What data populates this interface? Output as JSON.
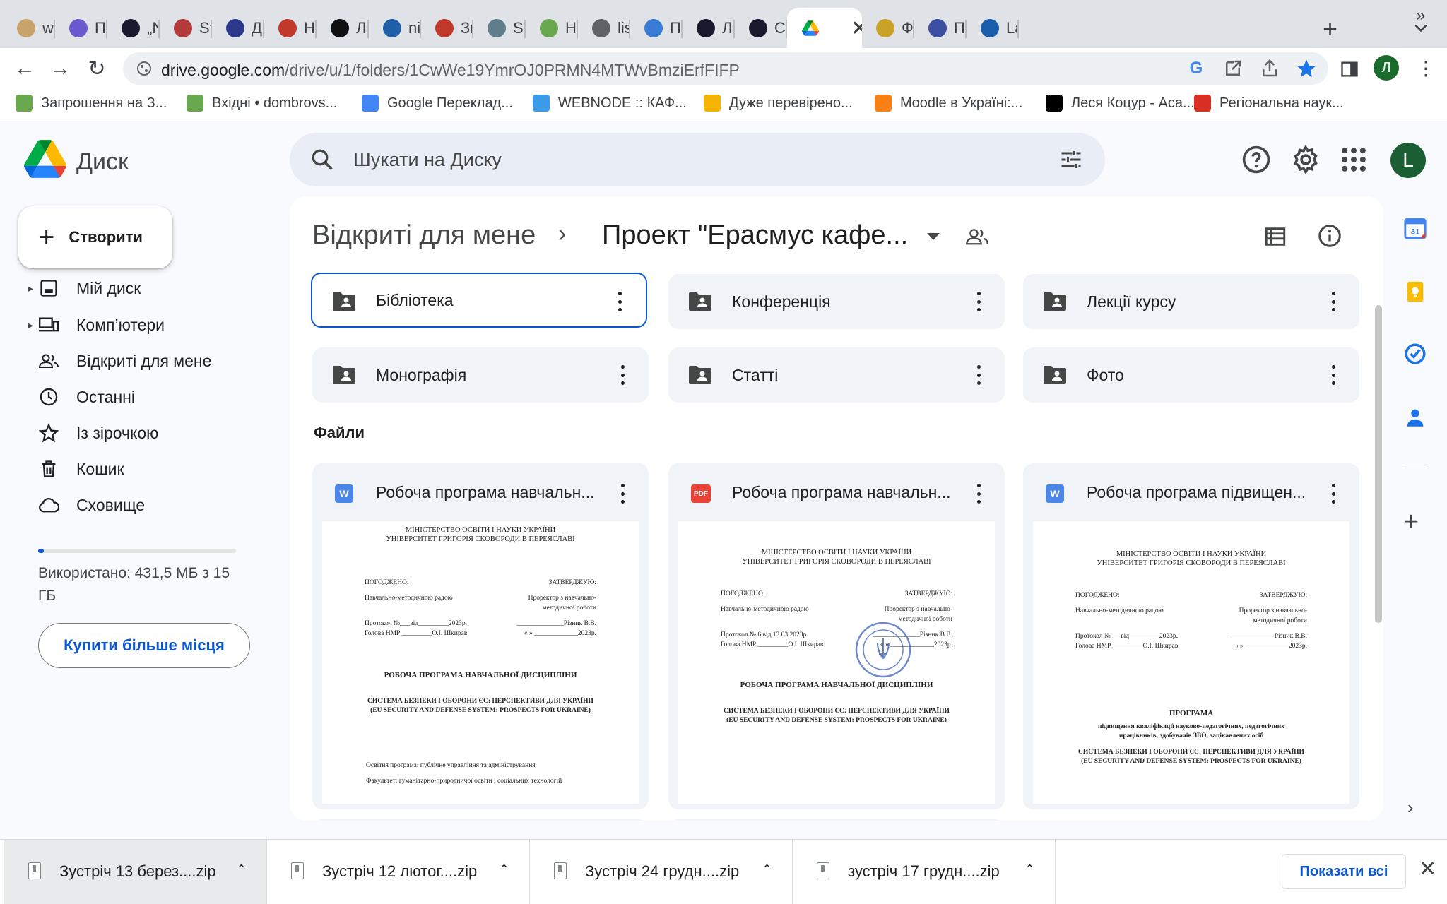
{
  "browser": {
    "tabs": [
      {
        "label": "ww",
        "icon": "plate-icon",
        "color": "#c9a46a"
      },
      {
        "label": "Прс",
        "icon": "c-circle-icon",
        "color": "#6a5acd"
      },
      {
        "label": "„Ne",
        "icon": "lrt-icon",
        "color": "#1a1a2e"
      },
      {
        "label": "Stra",
        "icon": "emblem-icon",
        "color": "#b33a3a"
      },
      {
        "label": "Дов",
        "icon": "cyrillic-d-icon",
        "color": "#2d3a8c"
      },
      {
        "label": "Нау",
        "icon": "flower-icon",
        "color": "#c0392b"
      },
      {
        "label": "Лит",
        "icon": "b-circle-icon",
        "color": "#111111"
      },
      {
        "label": "niss",
        "icon": "niss-icon",
        "color": "#1f5fa8"
      },
      {
        "label": "Звіт",
        "icon": "pdf-flag-icon",
        "color": "#c0392b"
      },
      {
        "label": "Sec",
        "icon": "doc-icon",
        "color": "#607d8b"
      },
      {
        "label": "Наг",
        "icon": "envelope-icon",
        "color": "#6aa84f"
      },
      {
        "label": "list.",
        "icon": "globe-icon",
        "color": "#5f6368"
      },
      {
        "label": "Пре",
        "icon": "puzzle-icon",
        "color": "#3a7bd5"
      },
      {
        "label": "Лев",
        "icon": "eu-icon",
        "color": "#1a1a2e"
      },
      {
        "label": "Cor",
        "icon": "eu-icon",
        "color": "#1a1a2e"
      },
      {
        "label": "",
        "icon": "google-drive-icon",
        "color": "#ffffff",
        "active": true
      },
      {
        "label": "Фак",
        "icon": "crest-icon",
        "color": "#c9a227"
      },
      {
        "label": "Про",
        "icon": "crest-icon",
        "color": "#3b4ea0"
      },
      {
        "label": "Lan",
        "icon": "lt-icon",
        "color": "#1a5dab"
      }
    ],
    "url_host": "drive.google.com",
    "url_path": "/drive/u/1/folders/1CwWe19YmrOJ0PRMN4MTWvBmziErfFIFP",
    "profile_initial": "Л",
    "bookmarks": [
      {
        "label": "Запрошення на З...",
        "icon": "envelope-icon",
        "color": "#6aa84f"
      },
      {
        "label": "Вхідні • dombrovs...",
        "icon": "envelope-icon",
        "color": "#6aa84f"
      },
      {
        "label": "Google Переклад...",
        "icon": "translate-icon",
        "color": "#4285f4"
      },
      {
        "label": "WEBNODE :: КАФ...",
        "icon": "webnode-icon",
        "color": "#3c9be8"
      },
      {
        "label": "Дуже перевірено...",
        "icon": "thumb-icon",
        "color": "#f4b400"
      },
      {
        "label": "Moodle в Україні:...",
        "icon": "moodle-icon",
        "color": "#f98012"
      },
      {
        "label": "Леся Коцур - Aca...",
        "icon": "academia-icon",
        "color": "#000000"
      },
      {
        "label": "Регіональна наук...",
        "icon": "flower-icon",
        "color": "#d93025"
      }
    ]
  },
  "drive": {
    "product_name": "Диск",
    "search_placeholder": "Шукати на Диску",
    "account_initial": "L",
    "new_button": "Створити",
    "nav": [
      {
        "label": "Мій диск",
        "icon": "my-drive-icon",
        "caret": true
      },
      {
        "label": "Комп’ютери",
        "icon": "computers-icon",
        "caret": true
      },
      {
        "label": "Відкриті для мене",
        "icon": "shared-icon",
        "caret": false
      },
      {
        "label": "Останні",
        "icon": "clock-icon",
        "caret": false
      },
      {
        "label": "Із зірочкою",
        "icon": "star-icon",
        "caret": false
      },
      {
        "label": "Кошик",
        "icon": "trash-icon",
        "caret": false
      },
      {
        "label": "Сховище",
        "icon": "cloud-icon",
        "caret": false
      }
    ],
    "storage": {
      "text": "Використано: 431,5 МБ з 15 ГБ",
      "used_fraction": 0.028
    },
    "buy_storage": "Купити більше місця"
  },
  "main": {
    "breadcrumb_root": "Відкриті для мене",
    "breadcrumb_current": "Проект \"Ерасмус кафе...",
    "folders": [
      {
        "name": "Бібліотека",
        "selected": true
      },
      {
        "name": "Конференція",
        "selected": false
      },
      {
        "name": "Лекції курсу",
        "selected": false
      },
      {
        "name": "Монографія",
        "selected": false
      },
      {
        "name": "Статті",
        "selected": false
      },
      {
        "name": "Фото",
        "selected": false
      }
    ],
    "files_heading": "Файли",
    "files": [
      {
        "name": "Робоча програма навчальн...",
        "type_badge": "W",
        "type_color": "#4a86e8",
        "preview": {
          "ministry": "МІНІСТЕРСТВО ОСВІТИ І НАУКИ УКРАЇНИ",
          "university": "УНІВЕРСИТЕТ ГРИГОРІЯ СКОВОРОДИ В ПЕРЕЯСЛАВІ",
          "agreed": "ПОГОДЖЕНО:",
          "approved": "ЗАТВЕРДЖУЮ:",
          "council": "Навчально-методичною радою",
          "prorector": "Проректор з навчально-",
          "prorector2": "методичної роботи",
          "protocol": "Протокол №___від_________2023р.",
          "signer": "______________Різник В.В.",
          "head": "Голова НМР _________О.І. Шкирав",
          "date": "« » _____________2023р.",
          "doc_title": "РОБОЧА ПРОГРАМА НАВЧАЛЬНОЇ ДИСЦИПЛІНИ",
          "subject": "СИСТЕМА БЕЗПЕКИ І ОБОРОНИ ЄС: ПЕРСПЕКТИВИ ДЛЯ УКРАЇНИ",
          "subject_en": "(EU SECURITY AND DEFENSE SYSTEM: PROSPECTS FOR UKRAINE)",
          "program": "Освітня програма: публічне управління та адміністрування",
          "faculty": "Факультет: гуманітарно-природничої освіти і соціальних технологій"
        }
      },
      {
        "name": "Робоча програма навчальн...",
        "type_badge": "PDF",
        "type_color": "#ea4335",
        "preview": {
          "ministry": "МІНІСТЕРСТВО ОСВІТИ І НАУКИ УКРАЇНИ",
          "university": "УНІВЕРСИТЕТ ГРИГОРІЯ СКОВОРОДИ В ПЕРЕЯСЛАВІ",
          "agreed": "ПОГОДЖЕНО:",
          "approved": "ЗАТВЕРДЖУЮ:",
          "council": "Навчально-методичною радою",
          "prorector": "Проректор з навчально-",
          "prorector2": "методичної роботи",
          "protocol": "Протокол № 6 від 13.03 2023р.",
          "signer": "______________Різник В.В.",
          "head": "Голова НМР _________О.І. Шкирав",
          "date": "« » _____________2023р.",
          "doc_title": "РОБОЧА ПРОГРАМА НАВЧАЛЬНОЇ ДИСЦИПЛІНИ",
          "subject": "СИСТЕМА БЕЗПЕКИ І ОБОРОНИ ЄС: ПЕРСПЕКТИВИ ДЛЯ УКРАЇНИ",
          "subject_en": "(EU SECURITY AND DEFENSE SYSTEM: PROSPECTS FOR UKRAINE)"
        }
      },
      {
        "name": "Робоча програма підвищен...",
        "type_badge": "W",
        "type_color": "#4a86e8",
        "preview": {
          "ministry": "МІНІСТЕРСТВО ОСВІТИ І НАУКИ УКРАЇНИ",
          "university": "УНІВЕРСИТЕТ ГРИГОРІЯ СКОВОРОДИ В ПЕРЕЯСЛАВІ",
          "agreed": "ПОГОДЖЕНО:",
          "approved": "ЗАТВЕРДЖУЮ:",
          "council": "Навчально-методичною радою",
          "prorector": "Проректор з навчально-",
          "prorector2": "методичної роботи",
          "protocol": "Протокол №___від_________2023р.",
          "signer": "______________Різник В.В.",
          "head": "Голова НМР _________О.І. Шкирав",
          "date": "« » _____________2023р.",
          "doc_title": "ПРОГРАМА",
          "doc_subtitle": "підвищення кваліфікації науково-педагогічних, педагогічних працівників, здобувачів ЗВО, зацікавлених осіб",
          "subject": "СИСТЕМА БЕЗПЕКИ І ОБОРОНИ ЄС: ПЕРСПЕКТИВИ ДЛЯ УКРАЇНИ",
          "subject_en": "(EU SECURITY AND DEFENSE SYSTEM: PROSPECTS FOR UKRAINE)"
        }
      }
    ]
  },
  "downloads": {
    "items": [
      {
        "name": "Зустріч 13 берез....zip"
      },
      {
        "name": "Зустріч 12 лютог....zip"
      },
      {
        "name": "Зустріч 24 грудн....zip"
      },
      {
        "name": "зустріч 17 грудн....zip"
      }
    ],
    "show_all": "Показати всі"
  },
  "colors": {
    "accent": "#0b57d0",
    "folder_bg": "#f0f4f9",
    "search_bg": "#e9eef6"
  }
}
